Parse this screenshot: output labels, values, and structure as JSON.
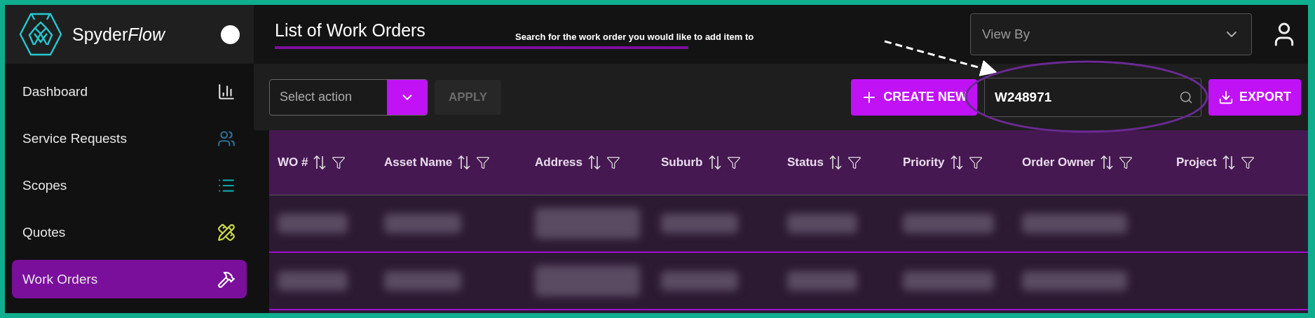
{
  "brand": {
    "name": "Spyder",
    "name_italic": "Flow"
  },
  "sidebar": {
    "items": [
      {
        "label": "Dashboard",
        "kind": "chart",
        "selected": false
      },
      {
        "label": "Service Requests",
        "kind": "people",
        "selected": false
      },
      {
        "label": "Scopes",
        "kind": "list",
        "selected": false
      },
      {
        "label": "Quotes",
        "kind": "ruler",
        "selected": false
      },
      {
        "label": "Work Orders",
        "kind": "hammer",
        "selected": true
      }
    ]
  },
  "page_title": "List of Work Orders",
  "annotation": "Search for the work order you would like to add item to",
  "view_by": {
    "placeholder": "View By"
  },
  "toolbar": {
    "action_select": {
      "placeholder": "Select action"
    },
    "apply": {
      "label": "APPLY",
      "disabled": true
    },
    "create": "CREATE NEW",
    "search": {
      "value": "W248971"
    },
    "export": "EXPORT"
  },
  "table": {
    "columns": [
      "WO #",
      "Asset Name",
      "Address",
      "Suburb",
      "Status",
      "Priority",
      "Order Owner",
      "Project"
    ],
    "rows": [
      {
        "cells": [
          {
            "kind": "redacted"
          },
          {
            "kind": "redacted"
          },
          {
            "kind": "redacted"
          },
          {
            "kind": "redacted"
          },
          {
            "kind": "redacted"
          },
          {
            "kind": "redacted"
          },
          {
            "kind": "redacted"
          },
          {
            "kind": "empty"
          }
        ]
      },
      {
        "cells": [
          {
            "kind": "redacted"
          },
          {
            "kind": "redacted"
          },
          {
            "kind": "redacted"
          },
          {
            "kind": "redacted"
          },
          {
            "kind": "redacted"
          },
          {
            "kind": "redacted"
          },
          {
            "kind": "redacted"
          },
          {
            "kind": "empty"
          }
        ]
      }
    ]
  }
}
